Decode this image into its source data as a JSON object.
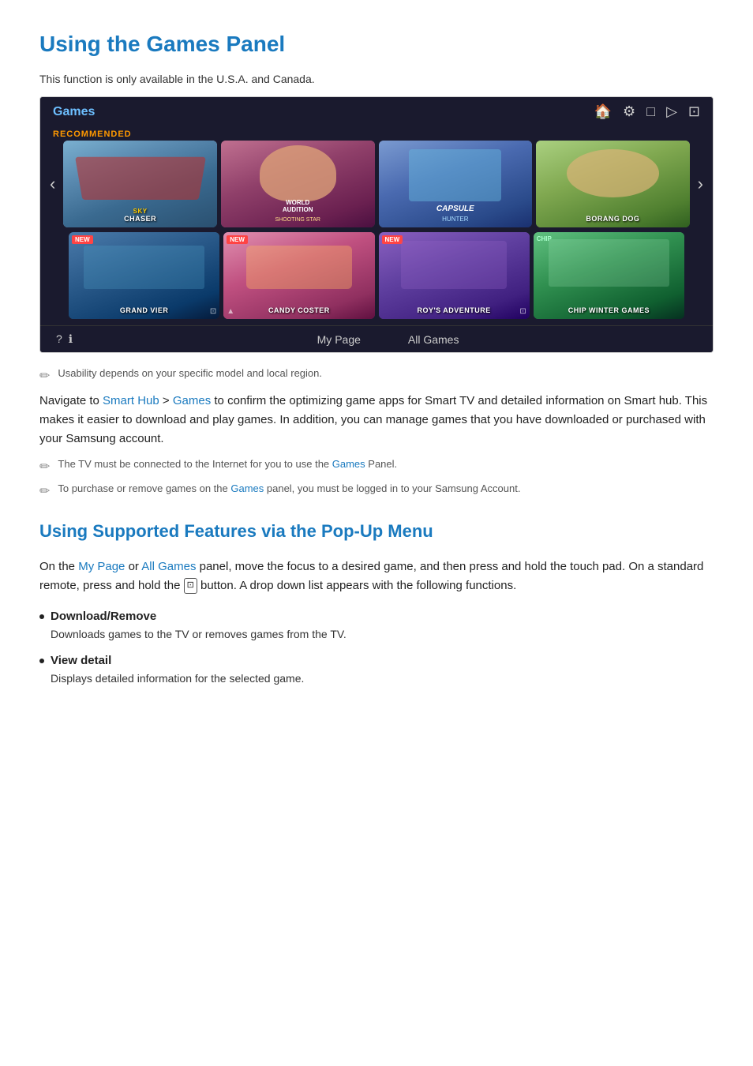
{
  "page": {
    "title": "Using the Games Panel",
    "intro": "This function is only available in the U.S.A. and Canada.",
    "panel": {
      "title": "Games",
      "icons": [
        "🏠",
        "⚙",
        "□",
        "▷",
        "⊡"
      ],
      "recommended_label": "RECOMMENDED",
      "games_row1": [
        {
          "name": "SKY CHASER",
          "style": "sky"
        },
        {
          "name": "WORLD AUDITION SHOOTING STAR",
          "style": "world"
        },
        {
          "name": "CAPSULE HUNTER",
          "style": "capsule"
        },
        {
          "name": "BORANG DOG",
          "style": "borang"
        }
      ],
      "games_row2": [
        {
          "name": "GRAND VIER",
          "style": "grand",
          "badge": "NEW"
        },
        {
          "name": "CANDY COSTER",
          "style": "candy",
          "badge": "NEW"
        },
        {
          "name": "ROY'S ADVENTURE",
          "style": "roy",
          "badge": "NEW"
        },
        {
          "name": "CHIP WINTER GAMES",
          "style": "chip"
        }
      ],
      "footer_links": [
        "My Page",
        "All Games"
      ],
      "arrow_left": "‹",
      "arrow_right": "›"
    },
    "note1": "Usability depends on your specific model and local region.",
    "main_paragraph": {
      "before_link1": "Navigate to ",
      "link1": "Smart Hub",
      "arrow": " > ",
      "link2": "Games",
      "after_link": " to confirm the optimizing game apps for Smart TV and detailed information on Smart hub. This makes it easier to download and play games. In addition, you can manage games that you have downloaded or purchased with your Samsung account."
    },
    "note2": {
      "text1": "The TV must be connected to the Internet for you to use the ",
      "link": "Games",
      "text2": " Panel."
    },
    "note3": {
      "text1": "To purchase or remove games on the ",
      "link": "Games",
      "text2": " panel, you must be logged in to your Samsung Account."
    },
    "section2": {
      "title": "Using Supported Features via the Pop-Up Menu",
      "intro_before": "On the ",
      "link1": "My Page",
      "or": " or ",
      "link2": "All Games",
      "intro_after": " panel, move the focus to a desired game, and then press and hold the touch pad. On a standard remote, press and hold the ",
      "remote_icon": "⊡",
      "intro_after2": " button. A drop down list appears with the following functions.",
      "bullets": [
        {
          "title": "Download/Remove",
          "desc": "Downloads games to the TV or removes games from the TV."
        },
        {
          "title": "View detail",
          "desc": "Displays detailed information for the selected game."
        }
      ]
    }
  }
}
